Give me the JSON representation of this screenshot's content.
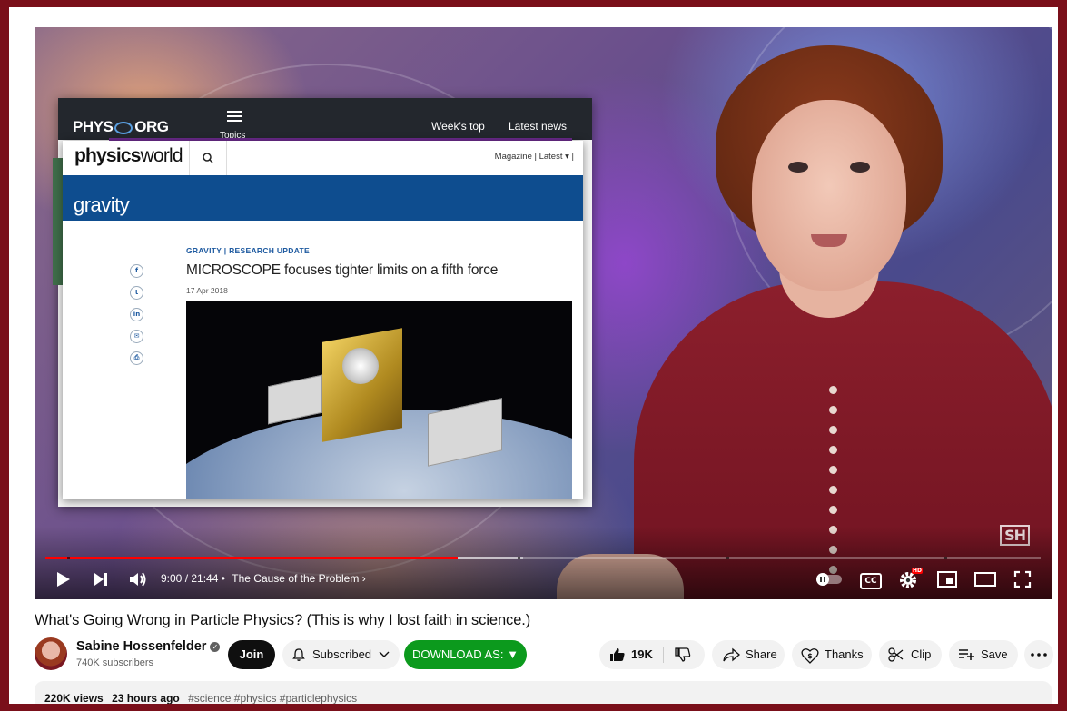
{
  "player": {
    "overlay": {
      "phys_logo_left": "PHYS",
      "phys_logo_right": "ORG",
      "menu_label": "Topics",
      "nav_weeks_top": "Week's top",
      "nav_latest_news": "Latest news",
      "pw_logo_bold": "physics",
      "pw_logo_light": "world",
      "pw_nav": "Magazine  |  Latest ▾  |",
      "pw_section": "gravity",
      "article_tag": "GRAVITY | RESEARCH UPDATE",
      "article_headline": "MICROSCOPE focuses tighter limits on a fifth force",
      "article_date": "17 Apr 2018",
      "share_icons": [
        "facebook-icon",
        "twitter-icon",
        "linkedin-icon",
        "email-icon",
        "print-icon"
      ]
    },
    "watermark": "SH",
    "time": "9:00 / 21:44",
    "chapter": "The Cause of the Problem",
    "progress_played_fraction": 0.414,
    "progress_buffered_fraction": 0.48,
    "hd_badge": "HD",
    "cc_label": "CC"
  },
  "video": {
    "title": "What's Going Wrong in Particle Physics? (This is why I lost faith in science.)"
  },
  "channel": {
    "name": "Sabine Hossenfelder",
    "subscribers": "740K subscribers",
    "join_label": "Join",
    "subscribed_label": "Subscribed",
    "download_label": "DOWNLOAD AS: ▼"
  },
  "actions": {
    "likes": "19K",
    "share": "Share",
    "thanks": "Thanks",
    "clip": "Clip",
    "save": "Save"
  },
  "description": {
    "views": "220K views",
    "age": "23 hours ago",
    "tags": "#science #physics #particlephysics"
  },
  "colors": {
    "frame": "#7a0f1a",
    "progress_red": "#ff0000",
    "download_green": "#0c9a1d",
    "physicsworld_blue": "#0e4d8f"
  }
}
